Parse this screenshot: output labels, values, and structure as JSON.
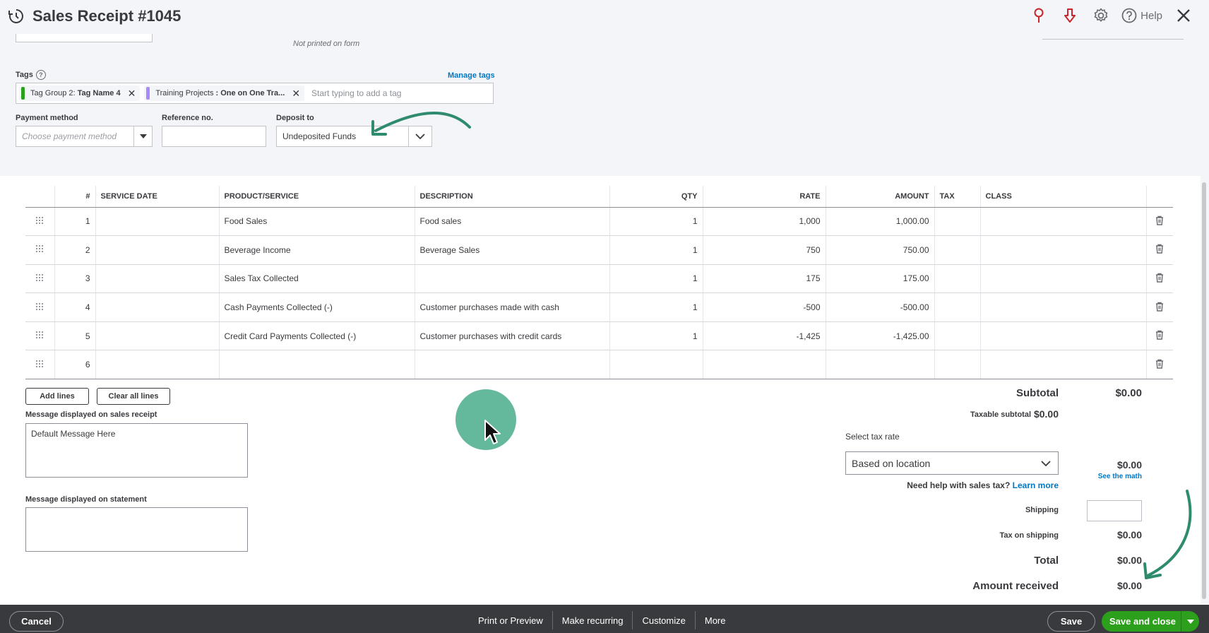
{
  "header": {
    "title": "Sales Receipt #1045",
    "help_label": "Help"
  },
  "form": {
    "not_printed_note": "Not printed on form",
    "tags_label": "Tags",
    "tags_help": "?",
    "manage_tags": "Manage tags",
    "tags": [
      {
        "group": "Tag Group 2:",
        "name": "Tag Name 4",
        "color": "#2ca01c"
      },
      {
        "group": "Training Projects",
        "name": ": One on One Tra...",
        "color": "#a78bfa"
      }
    ],
    "tag_placeholder": "Start typing to add a tag",
    "payment_method_label": "Payment method",
    "payment_method_placeholder": "Choose payment method",
    "reference_label": "Reference no.",
    "reference_value": "",
    "deposit_label": "Deposit to",
    "deposit_value": "Undeposited Funds"
  },
  "table": {
    "headers": [
      "#",
      "SERVICE DATE",
      "PRODUCT/SERVICE",
      "DESCRIPTION",
      "QTY",
      "RATE",
      "AMOUNT",
      "TAX",
      "CLASS"
    ],
    "rows": [
      {
        "num": "1",
        "date": "",
        "product": "Food Sales",
        "description": "Food sales",
        "qty": "1",
        "rate": "1,000",
        "amount": "1,000.00",
        "tax": "",
        "class": ""
      },
      {
        "num": "2",
        "date": "",
        "product": "Beverage Income",
        "description": "Beverage Sales",
        "qty": "1",
        "rate": "750",
        "amount": "750.00",
        "tax": "",
        "class": ""
      },
      {
        "num": "3",
        "date": "",
        "product": "Sales Tax Collected",
        "description": "",
        "qty": "1",
        "rate": "175",
        "amount": "175.00",
        "tax": "",
        "class": ""
      },
      {
        "num": "4",
        "date": "",
        "product": "Cash Payments Collected (-)",
        "description": "Customer purchases made with cash",
        "qty": "1",
        "rate": "-500",
        "amount": "-500.00",
        "tax": "",
        "class": ""
      },
      {
        "num": "5",
        "date": "",
        "product": "Credit Card Payments Collected (-)",
        "description": "Customer purchases with credit cards",
        "qty": "1",
        "rate": "-1,425",
        "amount": "-1,425.00",
        "tax": "",
        "class": ""
      },
      {
        "num": "6",
        "date": "",
        "product": "",
        "description": "",
        "qty": "",
        "rate": "",
        "amount": "",
        "tax": "",
        "class": ""
      }
    ],
    "add_lines": "Add lines",
    "clear_lines": "Clear all lines"
  },
  "messages": {
    "receipt_label": "Message displayed on sales receipt",
    "receipt_value": "Default Message Here",
    "statement_label": "Message displayed on statement",
    "statement_value": ""
  },
  "summary": {
    "subtotal_label": "Subtotal",
    "subtotal_value": "$0.00",
    "taxable_label": "Taxable subtotal",
    "taxable_value": "$0.00",
    "tax_rate_label": "Select tax rate",
    "tax_rate_value": "Based on location",
    "tax_value": "$0.00",
    "see_math": "See the math",
    "need_help": "Need help with sales tax?",
    "learn_more": "Learn more",
    "shipping_label": "Shipping",
    "tax_shipping_label": "Tax on shipping",
    "tax_shipping_value": "$0.00",
    "total_label": "Total",
    "total_value": "$0.00",
    "amount_received_label": "Amount received",
    "amount_received_value": "$0.00"
  },
  "footer": {
    "cancel": "Cancel",
    "print_preview": "Print or Preview",
    "make_recurring": "Make recurring",
    "customize": "Customize",
    "more": "More",
    "save": "Save",
    "save_and_close": "Save and close"
  },
  "colors": {
    "accent_green": "#2ca01c",
    "link_blue": "#0077c5",
    "annotation_green": "#2e8b6e",
    "icon_red": "#c9252c"
  }
}
